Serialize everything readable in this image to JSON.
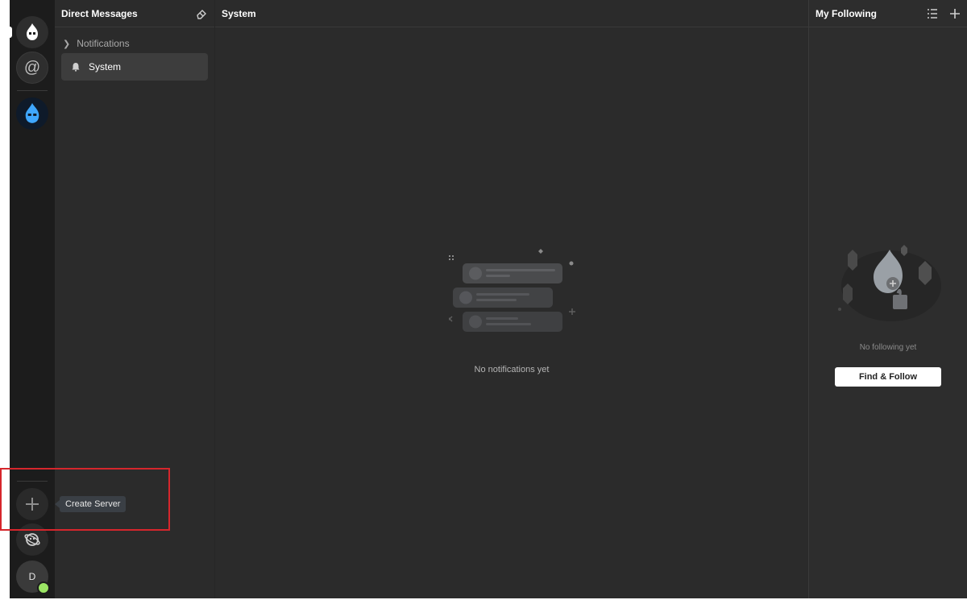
{
  "sidebar": {
    "header": {
      "title": "Direct Messages"
    },
    "category": {
      "label": "Notifications"
    },
    "items": [
      {
        "label": "System"
      }
    ]
  },
  "main": {
    "header": {
      "title": "System"
    },
    "empty_state": {
      "text": "No notifications yet"
    }
  },
  "right_panel": {
    "header": {
      "title": "My Following"
    },
    "empty_state": {
      "text": "No following yet"
    },
    "find_button": {
      "label": "Find & Follow"
    }
  },
  "rail": {
    "tooltip": "Create Server",
    "avatar_initial": "D"
  },
  "colors": {
    "accent_blue": "#3fa7ff",
    "status_online": "#9be564",
    "highlight_red": "#d6262c"
  }
}
